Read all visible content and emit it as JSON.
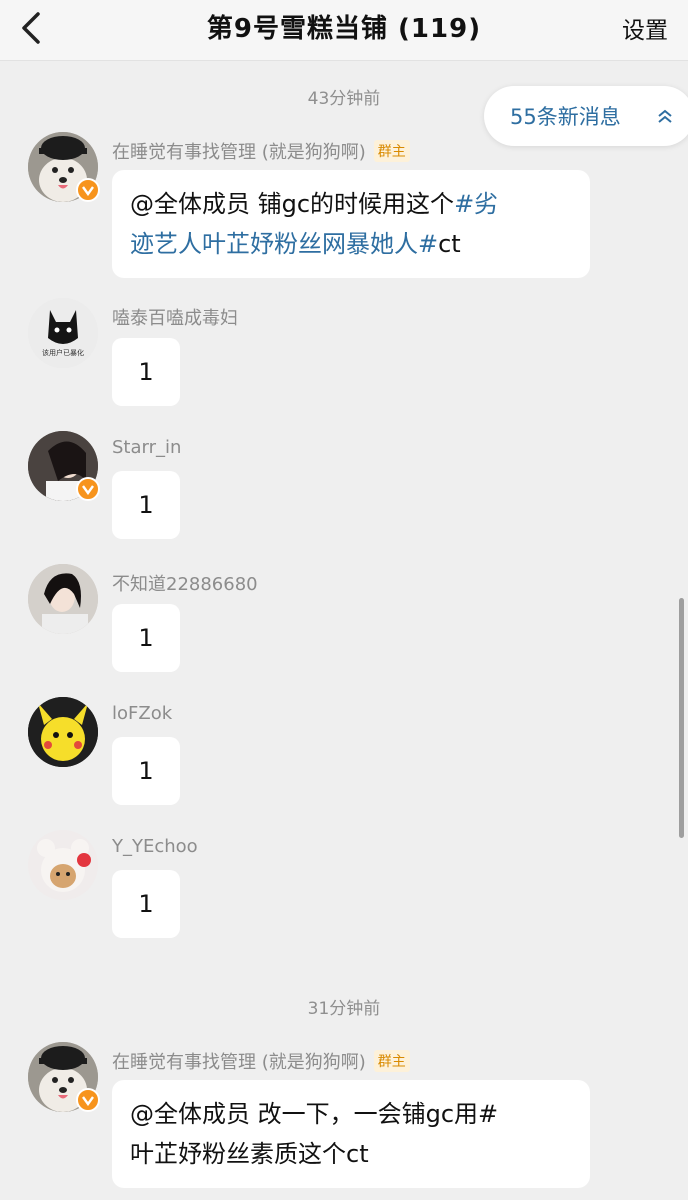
{
  "header": {
    "title": "第9号雪糕当铺 (119)",
    "settings_label": "设置"
  },
  "new_messages": {
    "label": "55条新消息"
  },
  "timestamps": [
    "43分钟前",
    "31分钟前"
  ],
  "messages": [
    {
      "sender": "在睡觉有事找管理 (就是狗狗啊)",
      "badge": "群主",
      "verified": true,
      "line1_plain": "@全体成员 铺gc的时候用这个",
      "line1_tag": "#劣",
      "line2_tag": "迹艺人叶芷妤粉丝网暴她人#",
      "line2_plain": "ct"
    },
    {
      "sender": "嗑泰百嗑成毒妇",
      "text": "1",
      "verified": false,
      "avatar_caption": "该用户已暴化"
    },
    {
      "sender": "Starr_in",
      "text": "1",
      "verified": true
    },
    {
      "sender": "不知道22886680",
      "text": "1",
      "verified": false
    },
    {
      "sender": "loFZok",
      "text": "1",
      "verified": false
    },
    {
      "sender": "Y_YEchoo",
      "text": "1",
      "verified": false
    },
    {
      "sender": "在睡觉有事找管理 (就是狗狗啊)",
      "badge": "群主",
      "verified": true,
      "line1": "@全体成员 改一下，一会铺gc用#",
      "line2": "叶芷妤粉丝素质这个ct"
    }
  ],
  "colors": {
    "background": "#efefef",
    "link": "#2e6ea1",
    "verified_badge": "#f7941d",
    "owner_badge_text": "#d98a00"
  },
  "icons": [
    "back-arrow-icon",
    "chevron-up-icon",
    "verified-icon"
  ]
}
